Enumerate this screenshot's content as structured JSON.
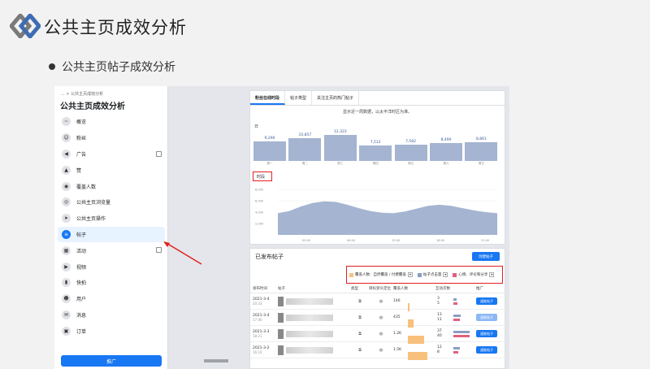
{
  "slide": {
    "title": "公共主页成效分析",
    "bullet": "公共主页帖子成效分析"
  },
  "sidebar": {
    "breadcrumb": "... > 公共主页成效分析",
    "title": "公共主页成效分析",
    "items": [
      {
        "label": "概览",
        "icon": "chart-icon",
        "external": false
      },
      {
        "label": "粉丝",
        "icon": "fans-icon",
        "external": false
      },
      {
        "label": "广告",
        "icon": "megaphone-icon",
        "external": true
      },
      {
        "label": "赞",
        "icon": "thumbs-up-icon",
        "external": false
      },
      {
        "label": "覆盖人数",
        "icon": "reach-icon",
        "external": false
      },
      {
        "label": "公共主页浏览量",
        "icon": "eye-icon",
        "external": false
      },
      {
        "label": "公共主页操作",
        "icon": "cursor-icon",
        "external": false
      },
      {
        "label": "帖子",
        "icon": "posts-icon",
        "external": false,
        "active": true
      },
      {
        "label": "活动",
        "icon": "calendar-icon",
        "external": true
      },
      {
        "label": "视频",
        "icon": "video-icon",
        "external": false
      },
      {
        "label": "快拍",
        "icon": "stories-icon",
        "external": false
      },
      {
        "label": "用户",
        "icon": "people-icon",
        "external": false
      },
      {
        "label": "消息",
        "icon": "messages-icon",
        "external": false
      },
      {
        "label": "订单",
        "icon": "orders-icon",
        "external": false
      }
    ],
    "bottom_button": "推广"
  },
  "tabs": [
    "粉丝在线时段",
    "帖子类型",
    "关注主页的热门帖子"
  ],
  "hint": "显示近一周数据，以太平洋时区为准。",
  "day_label": "日",
  "time_label": "时段",
  "chart_data": {
    "type": "bar",
    "categories": [
      "周一",
      "周二",
      "周三",
      "周四",
      "周五",
      "周六",
      "周日"
    ],
    "values": [
      9290,
      10857,
      12323,
      7512,
      7582,
      8490,
      8861
    ],
    "value_labels": [
      "9,290",
      "10,857",
      "12,323",
      "7,512",
      "7,582",
      "8,490",
      "8,861"
    ],
    "area": {
      "type": "area",
      "x_ticks": [
        "00:00",
        "06:00",
        "12:00",
        "18:00",
        "21:00"
      ],
      "y_ticks": [
        "8,000",
        "6,000",
        "4,000",
        "2,000"
      ],
      "ylim": [
        0,
        8000
      ],
      "values": [
        3800,
        4200,
        5000,
        5600,
        5900,
        5800,
        5300,
        4700,
        4200,
        3900,
        3800,
        4100,
        4600,
        5100,
        5300,
        5100,
        4700,
        4300,
        4000,
        3800
      ]
    }
  },
  "posts": {
    "title": "已发布帖子",
    "create_button": "创建帖子",
    "legend": [
      {
        "label": "覆盖人数：自然覆盖 / 付费覆盖",
        "color": "#f7c07d"
      },
      {
        "label": "帖子点击量",
        "color": "#8b9dc3"
      },
      {
        "label": "心情、评论和分享",
        "color": "#e0607e"
      }
    ],
    "columns": [
      "发布时间",
      "帖子",
      "类型",
      "目标受众定位",
      "覆盖人数",
      "互动次数",
      "推广"
    ],
    "rows": [
      {
        "date": "2021-3-4",
        "time": "20:33",
        "reach": "146",
        "reach_frac": 0.08,
        "eng1": "3",
        "eng2": "5",
        "boost": "速推帖子",
        "light": false
      },
      {
        "date": "2021-3-4",
        "time": "17:40",
        "reach": "435",
        "reach_frac": 0.25,
        "eng1": "13",
        "eng2": "11",
        "boost": "速推帖子",
        "light": true
      },
      {
        "date": "2021-3-3",
        "time": "18:21",
        "reach": "1.2K",
        "reach_frac": 0.7,
        "eng1": "37",
        "eng2": "40",
        "boost": "速推帖子",
        "light": false
      },
      {
        "date": "2021-3-2",
        "time": "16:10",
        "reach": "1.5K",
        "reach_frac": 0.85,
        "eng1": "12",
        "eng2": "8",
        "boost": "速推帖子",
        "light": false
      }
    ]
  }
}
